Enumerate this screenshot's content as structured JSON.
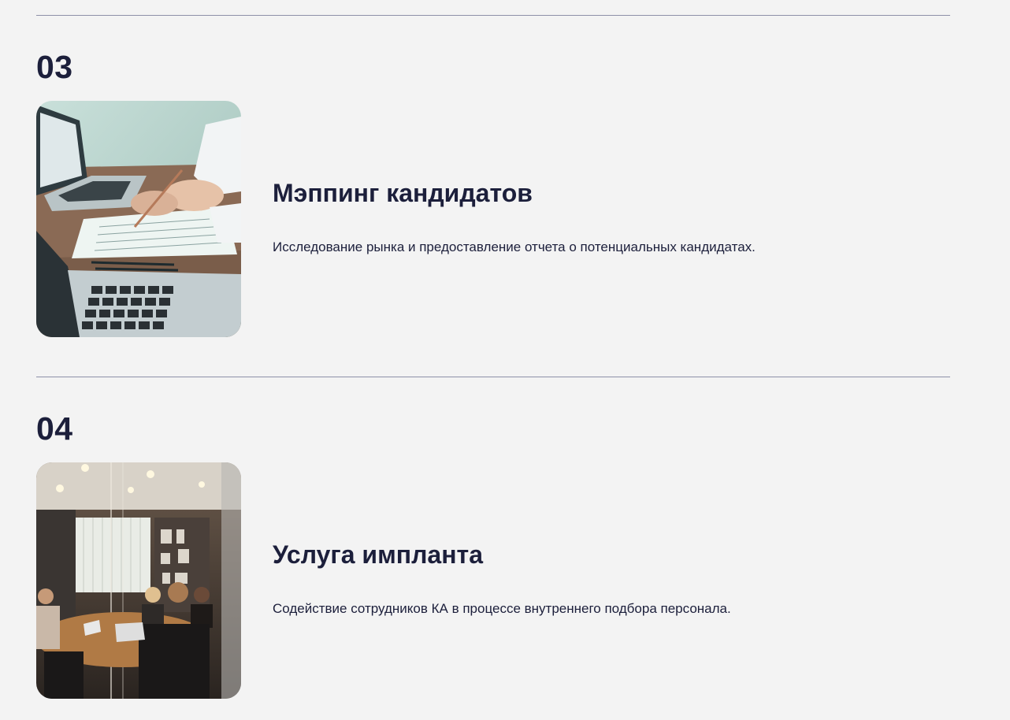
{
  "services": [
    {
      "number": "03",
      "title": "Мэппинг кандидатов",
      "description": "Исследование рынка и предоставление отчета о потенциальных кандидатах.",
      "image": "laptops-documents-photo"
    },
    {
      "number": "04",
      "title": "Услуга импланта",
      "description": "Содействие сотрудников КА в процессе внутреннего подбора персонала.",
      "image": "office-meeting-photo"
    }
  ],
  "colors": {
    "background": "#f3f3f3",
    "text": "#1c1f3b",
    "divider": "#8d90a8"
  }
}
